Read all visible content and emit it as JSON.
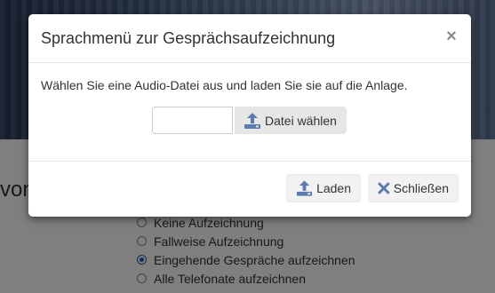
{
  "background": {
    "heading_fragment": "von",
    "radio_options": [
      {
        "label": "Keine Aufzeichnung",
        "checked": false
      },
      {
        "label": "Fallweise Aufzeichnung",
        "checked": false
      },
      {
        "label": "Eingehende Gespräche aufzeichnen",
        "checked": true
      },
      {
        "label": "Alle Telefonate aufzeichnen",
        "checked": false
      }
    ]
  },
  "modal": {
    "title": "Sprachmenü zur Gesprächsaufzeichnung",
    "close_symbol": "×",
    "body_text": "Wählen Sie eine Audio-Datei aus und laden Sie sie auf die Anlage.",
    "file_input_value": "",
    "choose_file_label": "Datei wählen",
    "load_label": "Laden",
    "close_label": "Schließen"
  },
  "colors": {
    "accent_icon": "#5d7bb0",
    "radio_checked": "#1c5fb5"
  },
  "icons": {
    "upload": "upload-icon",
    "close": "x-icon"
  }
}
